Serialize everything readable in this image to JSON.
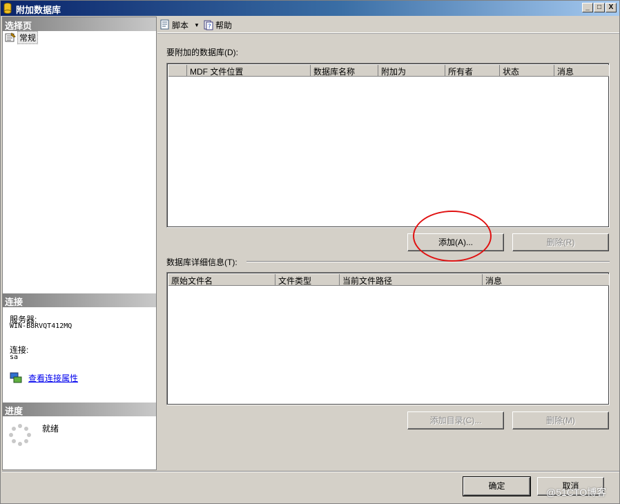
{
  "window": {
    "title": "附加数据库",
    "controls": {
      "minimize": "_",
      "maximize": "□",
      "close": "X"
    }
  },
  "sidebar": {
    "select_page_header": "选择页",
    "pages": [
      {
        "label": "常规"
      }
    ],
    "connection_header": "连接",
    "server_label": "服务器:",
    "server_value": "WIN-B8RVQT412MQ",
    "connection_label": "连接:",
    "connection_value": "sa",
    "view_props_link": "查看连接属性",
    "progress_header": "进度",
    "progress_status": "就绪"
  },
  "toolbar": {
    "script_label": "脚本",
    "help_label": "帮助"
  },
  "attach_section": {
    "label": "要附加的数据库(D):",
    "columns": [
      "MDF 文件位置",
      "数据库名称",
      "附加为",
      "所有者",
      "状态",
      "消息"
    ],
    "rows": [],
    "add_button": "添加(A)...",
    "remove_button": "删除(R)"
  },
  "details_section": {
    "label": "数据库详细信息(T):",
    "columns": [
      "原始文件名",
      "文件类型",
      "当前文件路径",
      "消息"
    ],
    "rows": [],
    "add_catalog_button": "添加目录(C)...",
    "remove_button": "删除(M)"
  },
  "footer": {
    "ok_button": "确定",
    "cancel_button": "取消"
  },
  "watermark": "@51CTO博客",
  "colors": {
    "titlebar_start": "#0a246a",
    "annotation_circle": "#e01010",
    "link": "#0000ee"
  }
}
